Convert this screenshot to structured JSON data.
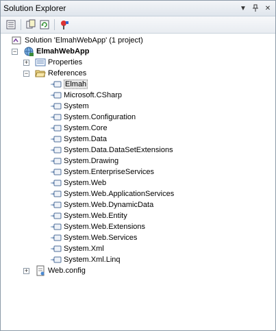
{
  "window": {
    "title": "Solution Explorer"
  },
  "titlebar": {
    "icons": [
      "dropdown-arrow-icon",
      "pin-icon",
      "close-icon"
    ]
  },
  "toolbar": {
    "icons": [
      "properties-icon",
      "show-all-files-icon",
      "refresh-icon",
      "class-view-icon"
    ]
  },
  "tree": {
    "solution": "Solution 'ElmahWebApp' (1 project)",
    "project": "ElmahWebApp",
    "properties": "Properties",
    "references": "References",
    "ref_items": [
      "Elmah",
      "Microsoft.CSharp",
      "System",
      "System.Configuration",
      "System.Core",
      "System.Data",
      "System.Data.DataSetExtensions",
      "System.Drawing",
      "System.EnterpriseServices",
      "System.Web",
      "System.Web.ApplicationServices",
      "System.Web.DynamicData",
      "System.Web.Entity",
      "System.Web.Extensions",
      "System.Web.Services",
      "System.Xml",
      "System.Xml.Linq"
    ],
    "selected_ref": "Elmah",
    "webconfig": "Web.config"
  },
  "colors": {
    "selection": "#e6e6e6",
    "title_bg": "#dfe5ec"
  }
}
